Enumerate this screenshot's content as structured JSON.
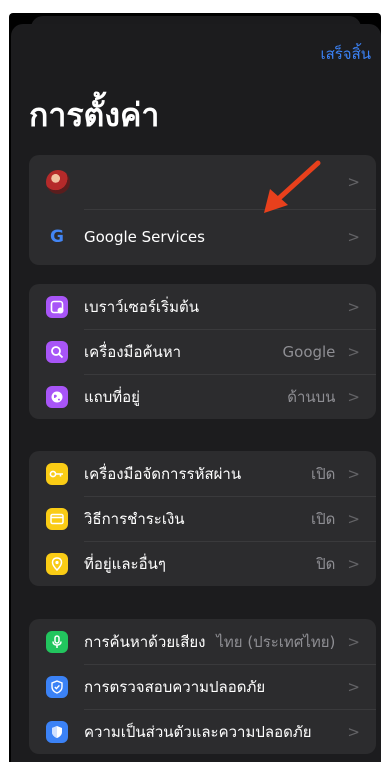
{
  "header": {
    "done_label": "เสร็จสิ้น",
    "title": "การตั้งค่า"
  },
  "account": {
    "profile_name": "",
    "google_services_label": "Google Services",
    "google_icon_letter": "G"
  },
  "browser_group": {
    "items": [
      {
        "label": "เบราว์เซอร์เริ่มต้น",
        "value": ""
      },
      {
        "label": "เครื่องมือค้นหา",
        "value": "Google"
      },
      {
        "label": "แถบที่อยู่",
        "value": "ด้านบน"
      }
    ]
  },
  "autofill_group": {
    "items": [
      {
        "label": "เครื่องมือจัดการรหัสผ่าน",
        "value": "เปิด"
      },
      {
        "label": "วิธีการชำระเงิน",
        "value": "เปิด"
      },
      {
        "label": "ที่อยู่และอื่นๆ",
        "value": "ปิด"
      }
    ]
  },
  "privacy_group": {
    "items": [
      {
        "label": "การค้นหาด้วยเสียง",
        "value": "ไทย (ประเทศไทย)"
      },
      {
        "label": "การตรวจสอบความปลอดภัย",
        "value": ""
      },
      {
        "label": "ความเป็นส่วนตัวและความปลอดภัย",
        "value": ""
      }
    ]
  },
  "chevron": ">",
  "colors": {
    "accent": "#3b82f6",
    "purple_icon": "#a855f7",
    "yellow_icon": "#facc15",
    "green_icon": "#22c55e",
    "blue_icon": "#3b82f6",
    "annotation_arrow": "#e8401c"
  }
}
